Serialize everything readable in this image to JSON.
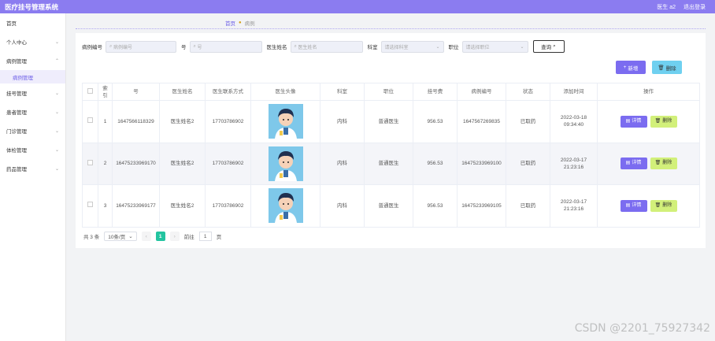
{
  "header": {
    "title": "医疗挂号管理系统",
    "user": "医生 a2",
    "logout": "退出登录"
  },
  "sidebar": {
    "items": [
      {
        "label": "首页",
        "chevron": ""
      },
      {
        "label": "个人中心",
        "chevron": "⌄"
      },
      {
        "label": "病例管理",
        "chevron": "⌃"
      },
      {
        "label": "挂号管理",
        "chevron": "⌄"
      },
      {
        "label": "患者管理",
        "chevron": "⌄"
      },
      {
        "label": "门诊管理",
        "chevron": "⌄"
      },
      {
        "label": "体检管理",
        "chevron": "⌄"
      },
      {
        "label": "药品管理",
        "chevron": "⌄"
      }
    ],
    "sub_active": "病例管理"
  },
  "breadcrumb": {
    "home": "首页",
    "current": "病例"
  },
  "search": {
    "f1_label": "病例编号",
    "f1_placeholder": "病例编号",
    "f2_label": "号",
    "f2_placeholder": "号",
    "f3_label": "医生姓名",
    "f3_placeholder": "医生姓名",
    "f4_label": "科室",
    "f4_placeholder": "请选择科室",
    "f5_label": "职位",
    "f5_placeholder": "请选择职位",
    "query_label": "查询"
  },
  "actions": {
    "add": "新增",
    "delete": "删除"
  },
  "table": {
    "headers": [
      "索引",
      "号",
      "医生姓名",
      "医生联系方式",
      "医生头像",
      "科室",
      "职位",
      "挂号费",
      "病例编号",
      "状态",
      "添加时间",
      "操作"
    ],
    "rows": [
      {
        "index": "1",
        "num": "1647566118329",
        "doctor": "医生姓名2",
        "phone": "17703786902",
        "dept": "内科",
        "position": "普通医生",
        "fee": "956.53",
        "case_no": "1647567269835",
        "status": "已取药",
        "time": "2022-03-18 09:34:40"
      },
      {
        "index": "2",
        "num": "16475233969170",
        "doctor": "医生姓名2",
        "phone": "17703786902",
        "dept": "内科",
        "position": "普通医生",
        "fee": "956.53",
        "case_no": "16475233969100",
        "status": "已取药",
        "time": "2022-03-17 21:23:16"
      },
      {
        "index": "3",
        "num": "16475233969177",
        "doctor": "医生姓名2",
        "phone": "17703786902",
        "dept": "内科",
        "position": "普通医生",
        "fee": "956.53",
        "case_no": "16475233969105",
        "status": "已取药",
        "time": "2022-03-17 21:23:16"
      }
    ],
    "detail_label": "详情",
    "remove_label": "删除"
  },
  "pager": {
    "total": "共 3 条",
    "size": "10条/页",
    "prev": "‹",
    "page": "1",
    "next": "›",
    "goto_prefix": "前往",
    "goto_value": "1",
    "goto_suffix": "页"
  },
  "watermark": "CSDN @2201_75927342",
  "colors": {
    "brand": "#8b7cf0",
    "accent": "#7b6cf0",
    "delete": "#d2f07a",
    "page_active": "#23c4a0"
  }
}
